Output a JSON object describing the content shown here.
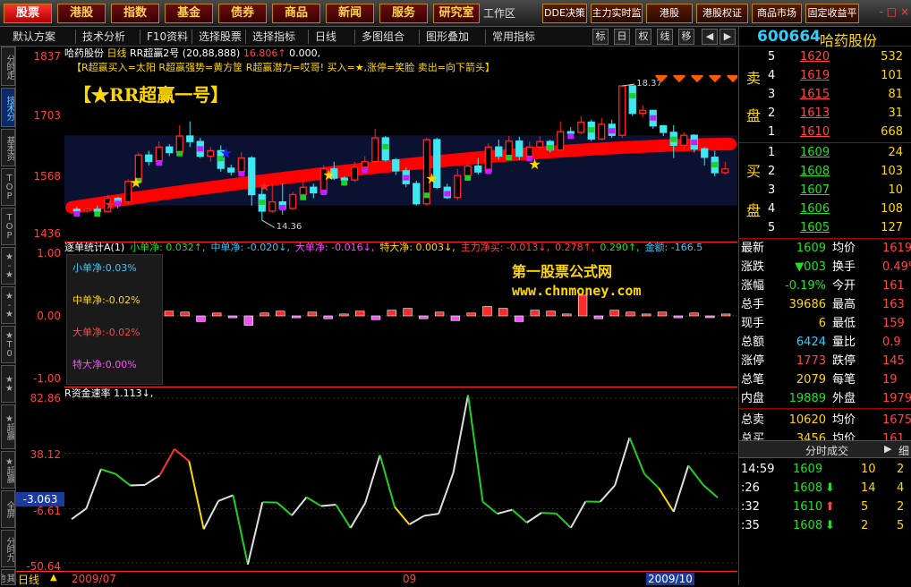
{
  "menu": {
    "items": [
      {
        "label": "股票",
        "active": true
      },
      {
        "label": "港股"
      },
      {
        "label": "指数"
      },
      {
        "label": "基金"
      },
      {
        "label": "债券"
      },
      {
        "label": "商品"
      },
      {
        "label": "新闻"
      },
      {
        "label": "服务"
      },
      {
        "label": "研究室"
      }
    ],
    "workspace": "工作区",
    "shortcuts": [
      "DDE决策",
      "主力实时监",
      "港股",
      "港股权证",
      "商品市场",
      "固定收益平"
    ],
    "window_controls": "- □ ×"
  },
  "toolbar": {
    "items": [
      "默认方案",
      "技术分析",
      "F10资料",
      "选择股票",
      "选择指标",
      "日线",
      "多图组合",
      "图形叠加",
      "常用指标"
    ],
    "icons": [
      "标",
      "日",
      "权",
      "线",
      "移"
    ]
  },
  "sidebar": {
    "tabs": [
      {
        "label": "分时走"
      },
      {
        "label": "技术分",
        "active": true
      },
      {
        "label": "基本资"
      },
      {
        "label": "TOP"
      },
      {
        "label": "TOP"
      },
      {
        "label": "★-★"
      },
      {
        "label": "★-★"
      },
      {
        "label": "★T0"
      },
      {
        "label": "★★"
      },
      {
        "label": "★超赢"
      },
      {
        "label": "★超赢"
      },
      {
        "label": "全屏"
      },
      {
        "label": "分时九"
      },
      {
        "label": "其他"
      }
    ]
  },
  "price_axis": [
    "1837",
    "1703",
    "1568",
    "1436"
  ],
  "chart_header": {
    "stock": "哈药股份",
    "period": "日线",
    "indicator": "RR超赢2号 (20,88,888)",
    "v1": "16.806↑",
    "v2": "0.000,"
  },
  "legend_line": "【R超赢买入=太阳 R超赢强势=黄方筐 R超赢潜力=哎哥! 买入=★,涨停=笑脸 卖出=向下箭头】",
  "brand_title": "【★RR超赢一号】",
  "annotations": {
    "high": "18.37",
    "low": "14.36"
  },
  "panel2": {
    "header": [
      {
        "text": "逐单统计A(1)",
        "color": "#ffffff"
      },
      {
        "text": "小单净: 0.032↑,",
        "color": "#22e022"
      },
      {
        "text": "中单净: -0.020↓,",
        "color": "#3cf"
      },
      {
        "text": "大单净: -0.016↓,",
        "color": "#ff4cff"
      },
      {
        "text": "特大净: 0.003↓,",
        "color": "#ffd700"
      },
      {
        "text": "主力净买: -0.013↓,",
        "color": "#ff4545"
      },
      {
        "text": "0.278↑,",
        "color": "#ff4545"
      },
      {
        "text": "0.290↑,",
        "color": "#22e022"
      },
      {
        "text": "金额: -166.5",
        "color": "#3cf"
      }
    ],
    "axis": [
      "1.00",
      "0.00",
      "-1.00"
    ],
    "box": [
      {
        "label": "小单净:",
        "value": "0.03%",
        "color": "#3cf"
      },
      {
        "label": "中单净:",
        "value": "-0.02%",
        "color": "#ffd700"
      },
      {
        "label": "大单净:",
        "value": "-0.02%",
        "color": "#ff4545"
      },
      {
        "label": "特大净:",
        "value": "0.00%",
        "color": "#ff4cff"
      }
    ],
    "watermark_1": "第一股票公式网",
    "watermark_2": "www.chnmoney.com"
  },
  "panel3": {
    "header": "R资金速率 1.113↓,",
    "axis": [
      "82.86",
      "38.12",
      "-6.61",
      "-50.64"
    ],
    "current": "-3.063"
  },
  "date_axis": {
    "mode": "日线",
    "labels": [
      "2009/07",
      "09",
      "2009/10"
    ]
  },
  "quote": {
    "code": "600664",
    "name": "哈药股份",
    "asks": [
      {
        "lvl": "5",
        "price": "1620",
        "vol": "532"
      },
      {
        "lvl": "4",
        "price": "1619",
        "vol": "101"
      },
      {
        "lvl": "3",
        "price": "1615",
        "vol": "81"
      },
      {
        "lvl": "2",
        "price": "1613",
        "vol": "31"
      },
      {
        "lvl": "1",
        "price": "1610",
        "vol": "668"
      }
    ],
    "bids": [
      {
        "lvl": "1",
        "price": "1609",
        "vol": "24"
      },
      {
        "lvl": "2",
        "price": "1608",
        "vol": "103"
      },
      {
        "lvl": "3",
        "price": "1607",
        "vol": "10"
      },
      {
        "lvl": "4",
        "price": "1606",
        "vol": "108"
      },
      {
        "lvl": "5",
        "price": "1605",
        "vol": "127"
      }
    ],
    "ask_title": [
      "卖",
      "盘"
    ],
    "bid_title": [
      "买",
      "盘"
    ],
    "stats": [
      {
        "k1": "最新",
        "v1": "1609",
        "c1": "#22e022",
        "k2": "均价",
        "v2": "1619"
      },
      {
        "k1": "涨跌",
        "v1": "▼003",
        "c1": "#22e022",
        "k2": "换手",
        "v2": "0.49%"
      },
      {
        "k1": "涨幅",
        "v1": "-0.19%",
        "c1": "#22e022",
        "k2": "今开",
        "v2": "161"
      },
      {
        "k1": "总手",
        "v1": "39686",
        "c1": "#ffd700",
        "k2": "最高",
        "v2": "163"
      },
      {
        "k1": "现手",
        "v1": "6",
        "c1": "#ffd700",
        "k2": "最低",
        "v2": "159"
      },
      {
        "k1": "总额",
        "v1": "6424",
        "c1": "#3cf",
        "k2": "量比",
        "v2": "0.9"
      },
      {
        "k1": "涨停",
        "v1": "1773",
        "c1": "#ff4545",
        "k2": "跌停",
        "v2": "145"
      },
      {
        "k1": "总笔",
        "v1": "2079",
        "c1": "#ffd700",
        "k2": "每笔",
        "v2": "19"
      },
      {
        "k1": "内盘",
        "v1": "19889",
        "c1": "#22e022",
        "k2": "外盘",
        "v2": "1979"
      },
      {
        "k1": "总卖",
        "v1": "10620",
        "c1": "#ffd700",
        "k2": "均价",
        "v2": "1675"
      },
      {
        "k1": "总买",
        "v1": "3456",
        "c1": "#ffd700",
        "k2": "均价",
        "v2": "161"
      }
    ],
    "ticks_title": "分时成交",
    "ticks_more": "细",
    "ticks": [
      {
        "t": "14:59",
        "p": "1609",
        "arrow": "",
        "v": "10",
        "n": "2",
        "pc": "#22e022"
      },
      {
        "t": ":26",
        "p": "1608",
        "arrow": "⬇",
        "v": "14",
        "n": "4",
        "pc": "#22e022"
      },
      {
        "t": ":32",
        "p": "1610",
        "arrow": "⬆",
        "v": "5",
        "n": "2",
        "pc": "#22e022"
      },
      {
        "t": ":35",
        "p": "1608",
        "arrow": "⬇",
        "v": "2",
        "n": "5",
        "pc": "#22e022"
      }
    ]
  },
  "chart_data": [
    {
      "type": "candlestick",
      "ylim": [
        14.36,
        18.37
      ],
      "candles": [
        [
          15.0,
          14.96,
          15.08,
          14.82
        ],
        [
          14.96,
          15.0,
          15.05,
          14.9
        ],
        [
          15.0,
          14.94,
          15.1,
          14.88
        ],
        [
          14.94,
          15.3,
          15.4,
          14.92
        ],
        [
          15.3,
          15.2,
          15.34,
          15.02
        ],
        [
          15.2,
          15.76,
          15.82,
          15.12
        ],
        [
          15.76,
          16.48,
          16.55,
          15.7
        ],
        [
          16.48,
          16.31,
          16.6,
          16.2
        ],
        [
          16.31,
          16.7,
          16.86,
          16.25
        ],
        [
          16.7,
          16.55,
          16.78,
          16.45
        ],
        [
          16.55,
          17.0,
          17.3,
          16.5
        ],
        [
          17.0,
          16.85,
          17.4,
          16.7
        ],
        [
          16.85,
          16.45,
          16.95,
          16.4
        ],
        [
          16.45,
          16.6,
          16.7,
          16.3
        ],
        [
          16.6,
          16.12,
          16.75,
          16.02
        ],
        [
          16.12,
          16.02,
          16.22,
          15.92
        ],
        [
          16.02,
          16.4,
          16.56,
          15.98
        ],
        [
          16.4,
          15.4,
          16.45,
          15.1
        ],
        [
          15.4,
          14.95,
          15.6,
          14.7
        ],
        [
          14.95,
          15.2,
          15.7,
          14.9
        ],
        [
          15.2,
          15.02,
          15.7,
          14.85
        ],
        [
          15.02,
          15.4,
          15.48,
          14.98
        ],
        [
          15.4,
          15.6,
          15.8,
          15.3
        ],
        [
          15.6,
          15.45,
          15.7,
          15.3
        ],
        [
          15.45,
          16.1,
          16.2,
          15.4
        ],
        [
          16.1,
          15.85,
          16.3,
          15.8
        ],
        [
          15.85,
          15.8,
          15.9,
          15.7
        ],
        [
          15.8,
          16.15,
          16.3,
          15.75
        ],
        [
          16.15,
          16.3,
          16.45,
          16.05
        ],
        [
          16.3,
          16.95,
          17.2,
          16.2
        ],
        [
          16.95,
          16.35,
          17.0,
          16.3
        ],
        [
          16.35,
          16.05,
          16.4,
          15.94
        ],
        [
          16.05,
          15.7,
          16.15,
          15.6
        ],
        [
          15.7,
          15.15,
          15.78,
          15.1
        ],
        [
          15.15,
          16.9,
          16.95,
          15.1
        ],
        [
          16.9,
          15.6,
          16.95,
          15.55
        ],
        [
          15.6,
          15.32,
          15.7,
          15.28
        ],
        [
          15.32,
          15.92,
          16.1,
          15.25
        ],
        [
          15.92,
          16.18,
          16.25,
          15.86
        ],
        [
          16.18,
          16.02,
          16.4,
          15.95
        ],
        [
          16.02,
          16.7,
          16.8,
          15.98
        ],
        [
          16.7,
          16.45,
          16.9,
          16.35
        ],
        [
          16.45,
          16.86,
          17.0,
          16.4
        ],
        [
          16.86,
          16.45,
          16.98,
          16.35
        ],
        [
          16.45,
          16.7,
          16.85,
          16.4
        ],
        [
          16.7,
          16.85,
          17.0,
          16.62
        ],
        [
          16.85,
          16.62,
          16.9,
          16.55
        ],
        [
          16.62,
          17.12,
          17.4,
          16.6
        ],
        [
          17.12,
          17.1,
          17.25,
          17.0
        ],
        [
          17.1,
          17.38,
          17.55,
          17.05
        ],
        [
          17.38,
          16.92,
          17.45,
          16.86
        ],
        [
          16.92,
          17.32,
          17.5,
          16.88
        ],
        [
          17.32,
          17.02,
          17.45,
          16.95
        ],
        [
          17.02,
          18.37,
          18.37,
          16.95
        ],
        [
          18.37,
          17.62,
          18.3,
          17.55
        ],
        [
          17.62,
          17.7,
          17.84,
          17.52
        ],
        [
          17.7,
          17.28,
          17.72,
          17.2
        ],
        [
          17.28,
          17.1,
          17.3,
          17.0
        ],
        [
          17.1,
          16.75,
          17.3,
          16.4
        ],
        [
          16.75,
          17.02,
          17.1,
          16.6
        ],
        [
          17.02,
          16.65,
          17.05,
          16.55
        ],
        [
          16.65,
          16.42,
          16.7,
          16.2
        ],
        [
          16.42,
          16.0,
          16.6,
          15.9
        ],
        [
          16.0,
          16.1,
          16.3,
          15.95
        ]
      ],
      "trend_band_start": 15.05,
      "trend_band_end": 16.78
    },
    {
      "type": "bar",
      "ylim": [
        -1.0,
        1.0
      ],
      "series": [
        {
          "name": "小单净",
          "values": [
            0.05,
            0.04,
            -0.06,
            0.03,
            -0.02,
            -0.1,
            0.03,
            0.05,
            -0.02,
            0.04,
            -0.03,
            0.02,
            0.05,
            -0.04,
            0.06,
            0.08,
            -0.03,
            0.04,
            -0.05,
            0.03,
            0.1,
            0.08,
            -0.06,
            0.06,
            0.05,
            0.02,
            0.22,
            -0.03,
            0.06,
            0.04,
            0.02,
            0.04,
            -0.02,
            0.03,
            -0.01,
            0.02
          ]
        }
      ]
    },
    {
      "type": "line",
      "ylim": [
        -50.64,
        82.86
      ],
      "series": [
        {
          "name": "R资金速率",
          "values": [
            -15.2,
            -6.6,
            25.3,
            21.4,
            12.1,
            12.6,
            20.3,
            41.6,
            31.8,
            -23.3,
            -0.4,
            4.2,
            -52.0,
            -1.5,
            -1.8,
            -12.2,
            2.6,
            -4.6,
            -3.5,
            -22.3,
            -2.0,
            36.8,
            -5.3,
            -19.5,
            -12.5,
            -10.8,
            22.7,
            85.4,
            -1.1,
            -10.8,
            -7.6,
            -18.0,
            -10.1,
            -10.6,
            -22.2,
            -0.9,
            -1.1,
            12.2,
            50.9,
            21.6,
            9.7,
            -9.2,
            28.2,
            12.7,
            2.2
          ]
        }
      ]
    }
  ]
}
